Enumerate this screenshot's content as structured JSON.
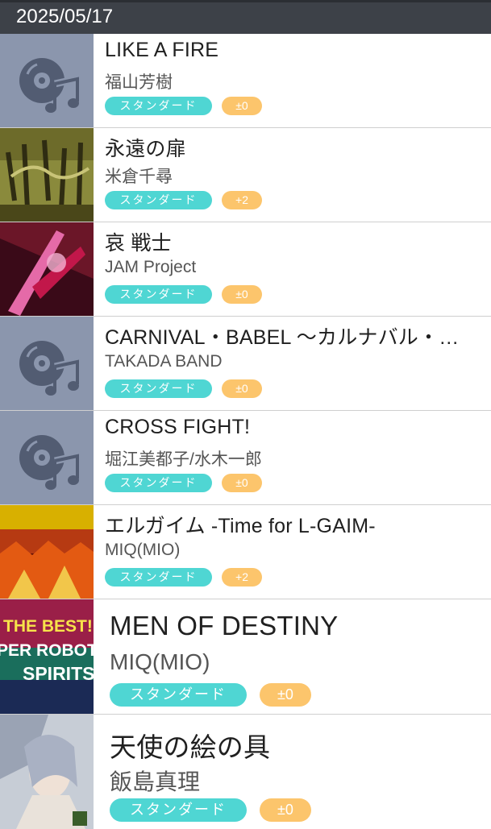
{
  "header": {
    "date": "2025/05/17"
  },
  "icons": {
    "placeholder": "music-disc-icon"
  },
  "colors": {
    "header_bg": "#3d4148",
    "badge_standard": "#4fd6d3",
    "badge_key": "#fcc56c",
    "placeholder_bg": "#8b96ad"
  },
  "songs": [
    {
      "title": "LIKE A FIRE",
      "artist": "福山芳樹",
      "difficulty": "スタンダード",
      "key": "±0",
      "jacket": "placeholder"
    },
    {
      "title": "永遠の扉",
      "artist": "米倉千尋",
      "difficulty": "スタンダード",
      "key": "+2",
      "jacket": "art"
    },
    {
      "title": "哀 戦士",
      "artist": "JAM Project",
      "difficulty": "スタンダード",
      "key": "±0",
      "jacket": "art"
    },
    {
      "title": "CARNIVAL・BABEL ～カルナバル・…",
      "artist": "TAKADA BAND",
      "difficulty": "スタンダード",
      "key": "±0",
      "jacket": "placeholder"
    },
    {
      "title": "CROSS FIGHT!",
      "artist": "堀江美都子/水木一郎",
      "difficulty": "スタンダード",
      "key": "±0",
      "jacket": "placeholder"
    },
    {
      "title": "エルガイム -Time for L-GAIM-",
      "artist": "MIQ(MIO)",
      "difficulty": "スタンダード",
      "key": "+2",
      "jacket": "art"
    },
    {
      "title": "MEN OF DESTINY",
      "artist": "MIQ(MIO)",
      "difficulty": "スタンダード",
      "key": "±0",
      "jacket": "art",
      "jacket_text": [
        "THE BEST!!",
        "PER ROBOT",
        "SPIRITS"
      ]
    },
    {
      "title": "天使の絵の具",
      "artist": "飯島真理",
      "difficulty": "スタンダード",
      "key": "±0",
      "jacket": "art"
    }
  ]
}
